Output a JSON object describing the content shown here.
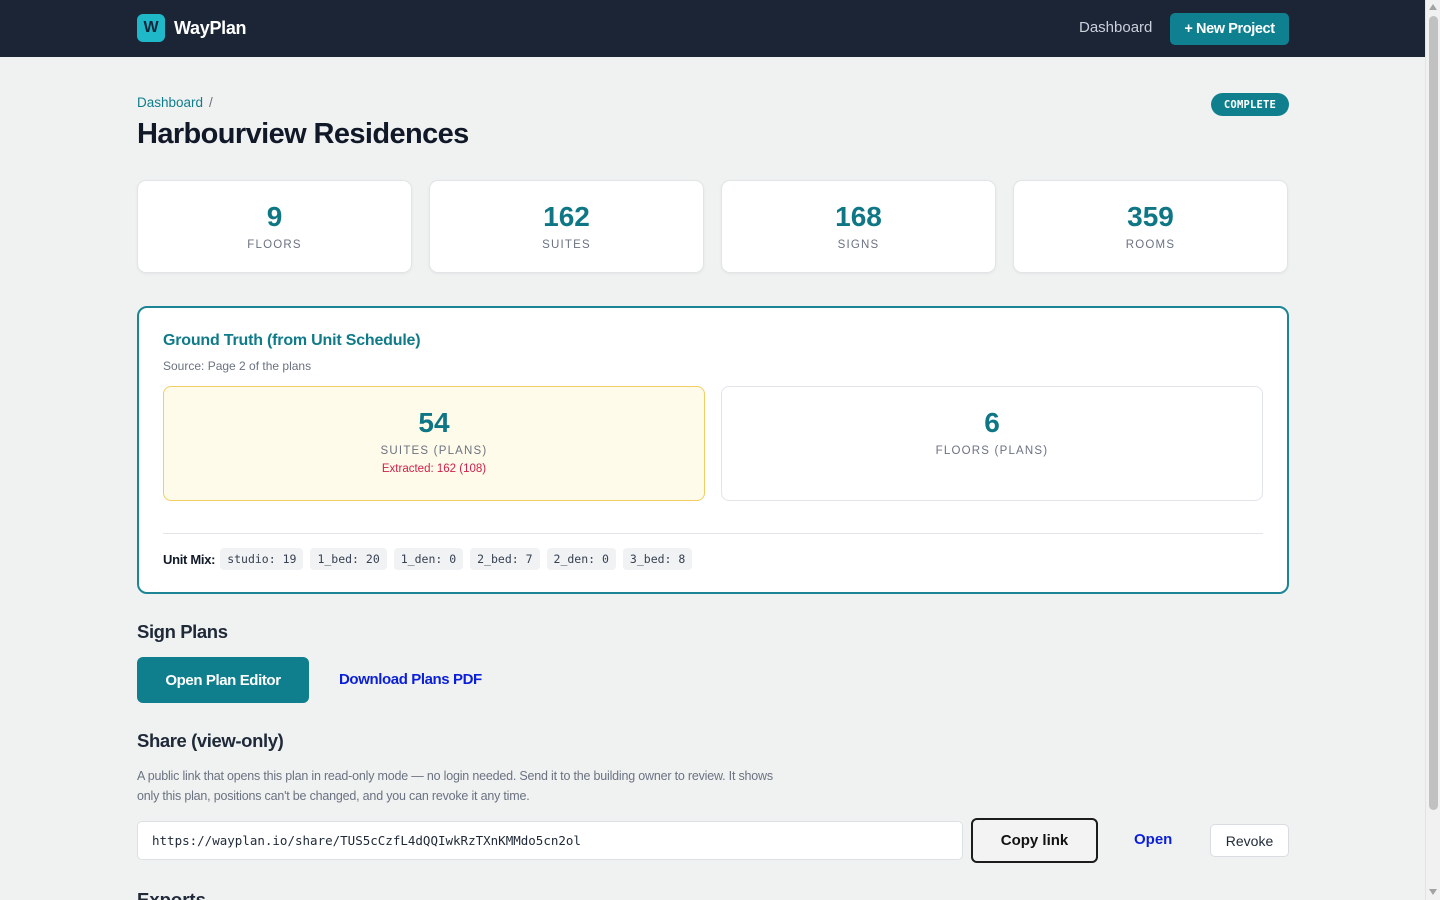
{
  "app": {
    "name": "WayPlan",
    "logo_letter": "W",
    "nav": {
      "dashboard_label": "Dashboard",
      "new_project_label": "+ New Project"
    }
  },
  "breadcrumb": {
    "root": "Dashboard",
    "separator": "/"
  },
  "project": {
    "title": "Harbourview Residences",
    "status": "COMPLETE"
  },
  "stats": [
    {
      "value": "9",
      "label": "FLOORS"
    },
    {
      "value": "162",
      "label": "SUITES"
    },
    {
      "value": "168",
      "label": "SIGNS"
    },
    {
      "value": "359",
      "label": "ROOMS"
    }
  ],
  "ground_truth": {
    "title": "Ground Truth (from Unit Schedule)",
    "source": "Source: Page 2 of the plans",
    "suites": {
      "value": "54",
      "label": "SUITES (PLANS)",
      "extracted": "Extracted: 162 (108)"
    },
    "floors": {
      "value": "6",
      "label": "FLOORS (PLANS)"
    },
    "unit_mix_label": "Unit Mix:",
    "unit_mix": [
      "studio: 19",
      "1_bed: 20",
      "1_den: 0",
      "2_bed: 7",
      "2_den: 0",
      "3_bed: 8"
    ]
  },
  "sign_plans": {
    "heading": "Sign Plans",
    "open_editor_label": "Open Plan Editor",
    "download_label": "Download Plans PDF"
  },
  "share": {
    "heading": "Share (view-only)",
    "description": "A public link that opens this plan in read-only mode — no login needed. Send it to the building owner to review. It shows only this plan, positions can't be changed, and you can revoke it any time.",
    "url": "https://wayplan.io/share/TUS5cCzfL4dQQIwkRzTXnKMMdo5cn2ol",
    "copy_label": "Copy link",
    "open_label": "Open",
    "revoke_label": "Revoke"
  },
  "exports": {
    "heading": "Exports"
  },
  "colors": {
    "nav_bg": "#1b2536",
    "accent": "#0f7f8e",
    "warning_bg": "#fffbeb",
    "warning_border": "#f1cd62",
    "error_text": "#d11f47",
    "link": "#0b1fd8"
  }
}
